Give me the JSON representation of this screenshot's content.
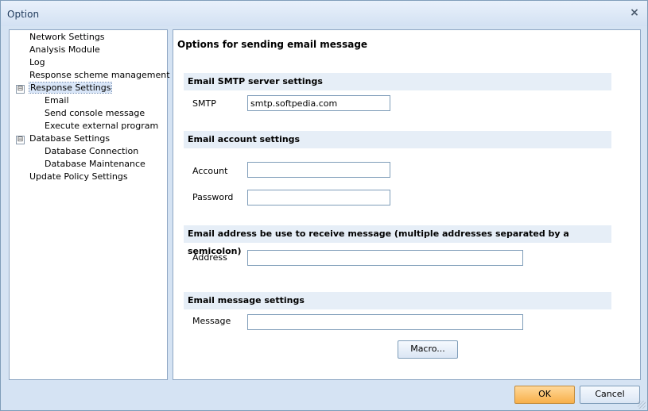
{
  "window": {
    "title": "Option",
    "close_glyph": "×"
  },
  "tree": {
    "items": [
      {
        "label": "Network Settings"
      },
      {
        "label": "Analysis Module"
      },
      {
        "label": "Log"
      },
      {
        "label": "Response scheme management"
      },
      {
        "label": "Response Settings",
        "expander": "⊟"
      },
      {
        "label": "Email"
      },
      {
        "label": "Send console message"
      },
      {
        "label": "Execute external program"
      },
      {
        "label": "Database Settings",
        "expander": "⊟"
      },
      {
        "label": "Database Connection"
      },
      {
        "label": "Database Maintenance"
      },
      {
        "label": "Update Policy Settings"
      }
    ]
  },
  "panel": {
    "title": "Options for sending email message",
    "smtp_section": "Email SMTP server settings",
    "smtp_label": "SMTP",
    "smtp_value": "smtp.softpedia.com",
    "account_section": "Email account settings",
    "account_label": "Account",
    "account_value": "",
    "password_label": "Password",
    "password_value": "",
    "address_section": "Email address  be use to receive message (multiple addresses separated by a semicolon)",
    "address_label": "Address",
    "address_value": "",
    "message_section": "Email message settings",
    "message_label": "Message",
    "message_value": "",
    "macro_button": "Macro..."
  },
  "footer": {
    "ok": "OK",
    "cancel": "Cancel"
  }
}
